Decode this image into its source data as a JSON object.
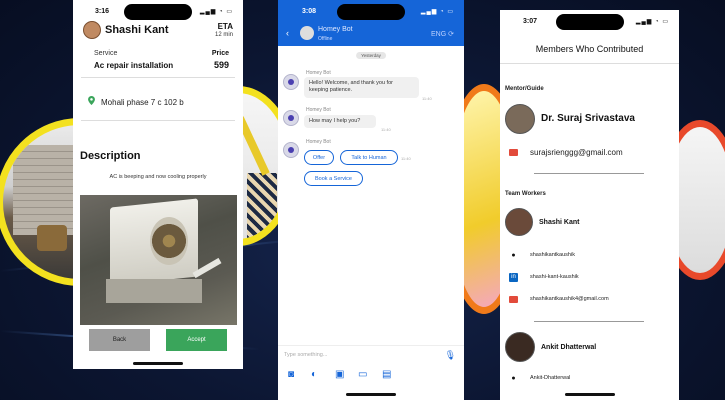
{
  "colors": {
    "accent_blue": "#1565d8",
    "accept_green": "#3aa55b",
    "back_gray": "#9e9e9e",
    "ring_yellow": "#f3e11f",
    "ring_orange": "#f07a1a",
    "ring_red": "#e8492b",
    "mail_red": "#e24b3b",
    "linkedin_blue": "#0a66c2"
  },
  "booking": {
    "status_time": "3:16",
    "customer_name": "Shashi Kant",
    "eta_label": "ETA",
    "eta_value": "12 min",
    "service_label": "Service",
    "service_value": "Ac repair installation",
    "price_label": "Price",
    "price_value": "599",
    "location": "Mohali phase 7 c 102 b",
    "description_title": "Description",
    "description_text": "AC is beeping and now cooling properly",
    "back_label": "Back",
    "accept_label": "Accept",
    "location_icon": "location-pin-icon"
  },
  "chat": {
    "status_time": "3:08",
    "bot_name": "Homey Bot",
    "bot_status": "Offline",
    "header_right": "ENG",
    "day_label": "Yesterday",
    "messages": [
      {
        "sender": "Homey Bot",
        "text_line1": "Hello! Welcome, and thank you for",
        "text_line2": "keeping patience.",
        "time": "11:40"
      },
      {
        "sender": "Homey Bot",
        "text_line1": "How may I help you?",
        "text_line2": "",
        "time": "11:40"
      },
      {
        "sender": "Homey Bot",
        "text_line1": "",
        "text_line2": "",
        "time": "11:40"
      }
    ],
    "chips": [
      "Offer",
      "Talk to Human",
      "Book a Service"
    ],
    "input_placeholder": "Type something...",
    "attach_icons": [
      "camera-icon",
      "video-icon",
      "image-icon",
      "record-icon",
      "document-icon"
    ]
  },
  "members": {
    "status_time": "3:07",
    "title": "Members Who Contributed",
    "mentor_section": "Mentor/Guide",
    "mentor_name": "Dr. Suraj Srivastava",
    "mentor_email": "surajsrienggg@gmail.com",
    "team_section": "Team Workers",
    "worker1_name": "Shashi Kant",
    "worker1_github": "shashikantkaushik",
    "worker1_linkedin": "shashi-kant-kaushik",
    "worker1_email": "shashikantkaushik4@gmail.com",
    "worker2_name": "Ankit Dhatterwal",
    "worker2_github": "Ankit-Dhatterwal"
  }
}
